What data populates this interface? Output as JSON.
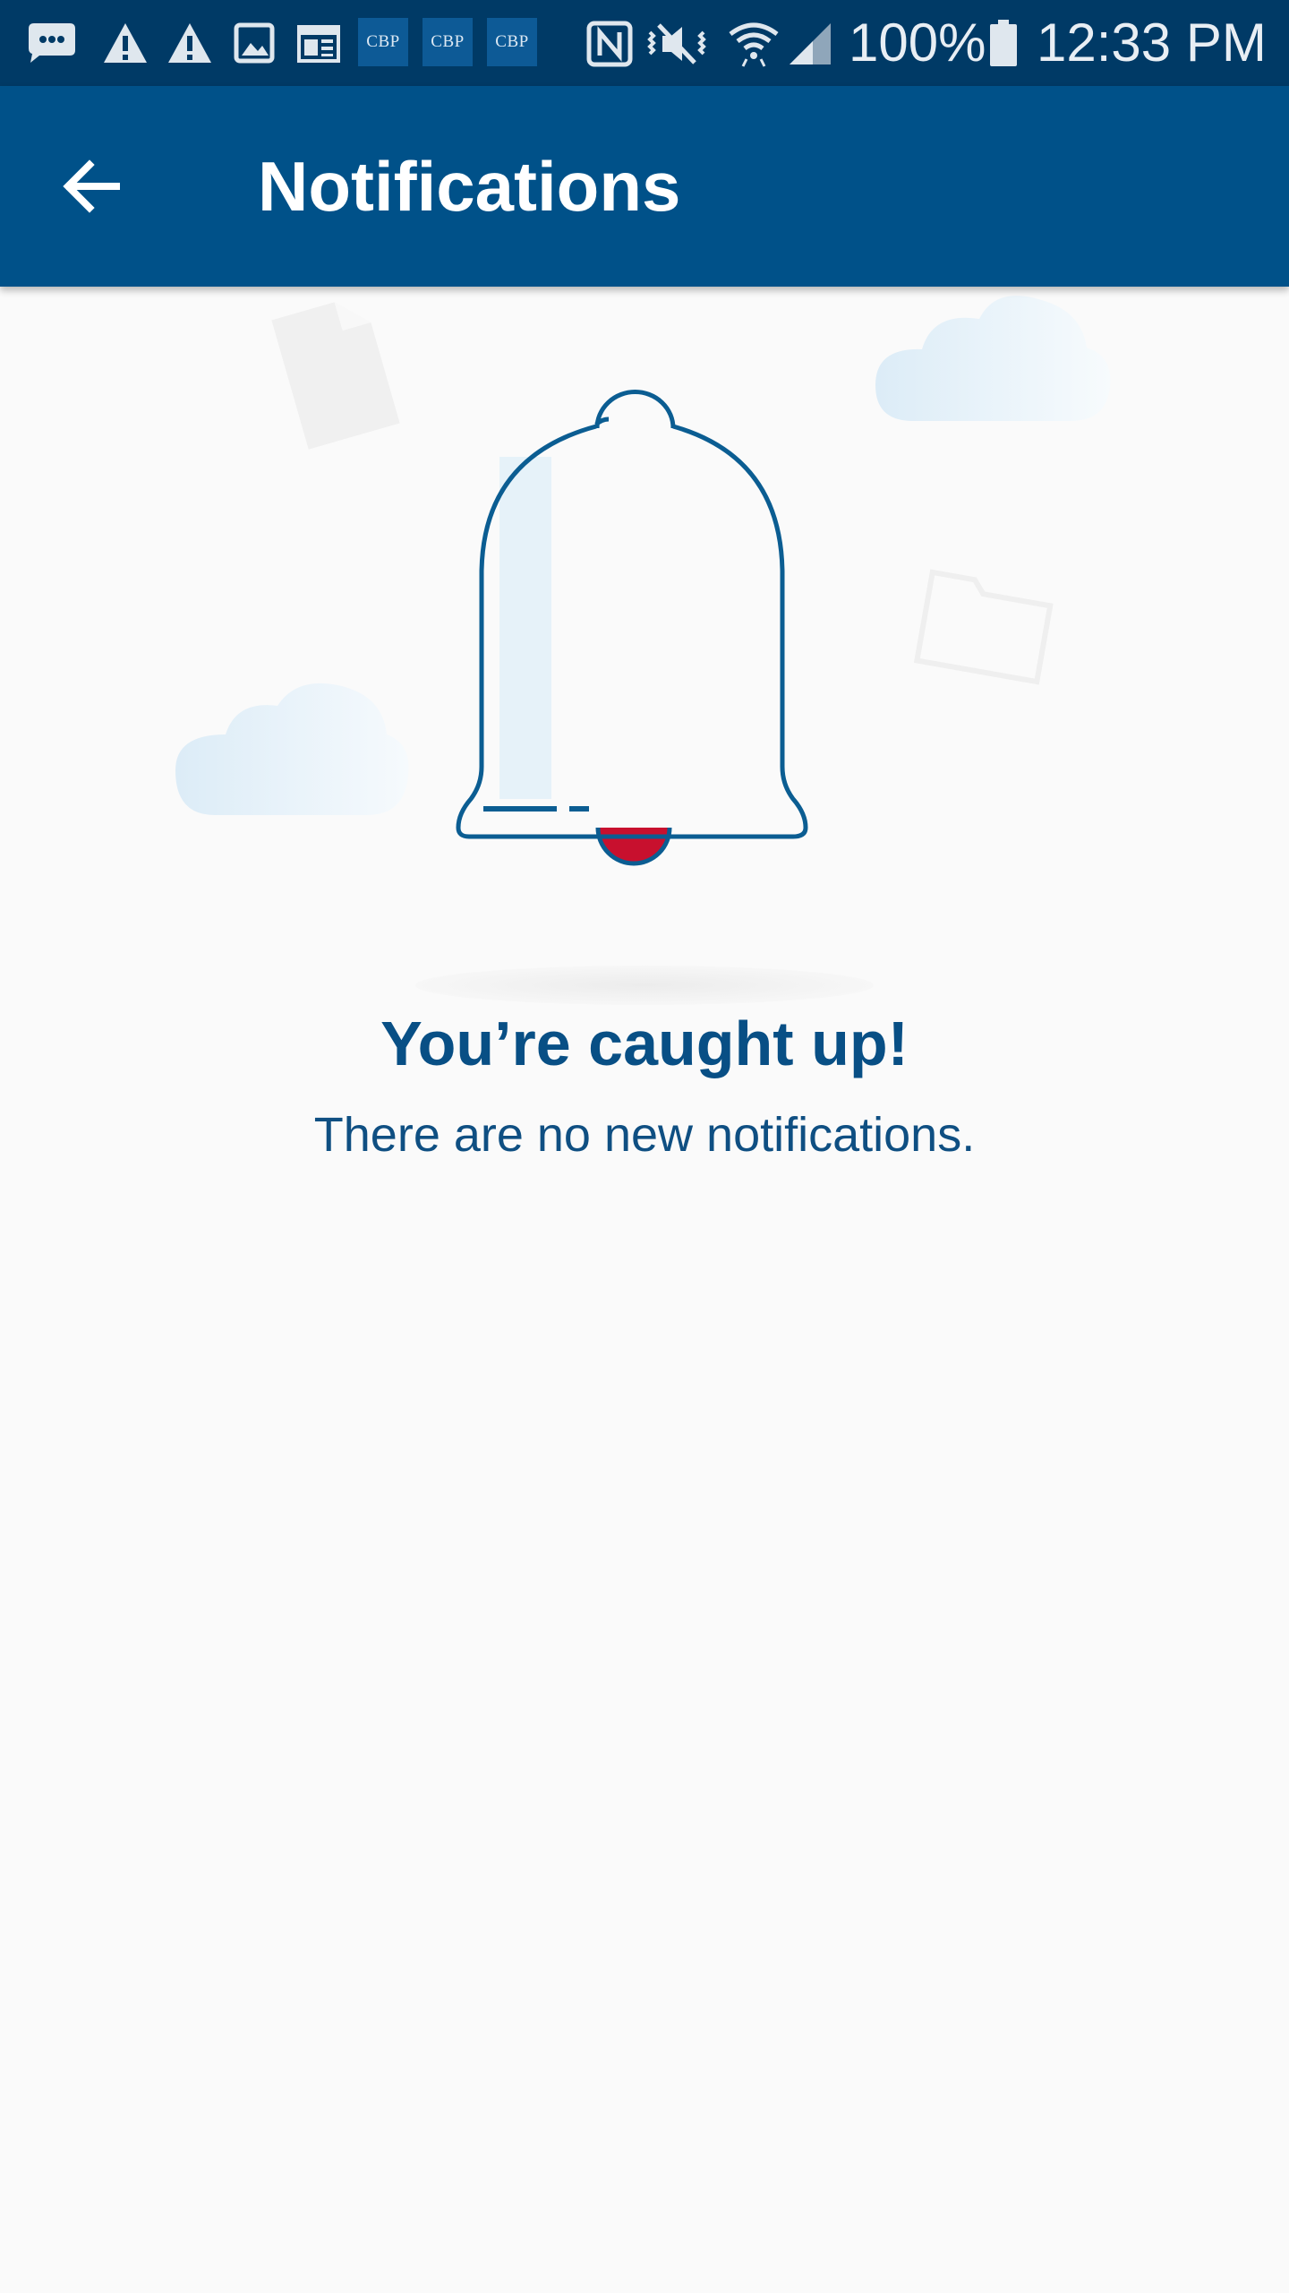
{
  "status_bar": {
    "battery_percent": "100%",
    "time": "12:33 PM",
    "badge_label": "CBP",
    "left_icons": [
      "messages-icon",
      "warning-icon",
      "warning-icon",
      "image-icon",
      "calendar-icon",
      "cbp-badge",
      "cbp-badge",
      "cbp-badge"
    ],
    "right_icons": [
      "nfc-icon",
      "vibrate-mute-icon",
      "wifi-icon",
      "cell-signal-icon",
      "battery-icon"
    ]
  },
  "app_bar": {
    "title": "Notifications",
    "back_icon": "arrow-back-icon"
  },
  "empty_state": {
    "title": "You’re caught up!",
    "subtitle": "There are no new notifications.",
    "illustration": "bell-icon"
  },
  "colors": {
    "status_bar": "#003a66",
    "app_bar": "#005189",
    "background": "#fafafa",
    "title_text": "#084f85",
    "bell_outline": "#0b5d92",
    "bell_clapper": "#c8102e",
    "cloud": "#e3f0f8"
  }
}
